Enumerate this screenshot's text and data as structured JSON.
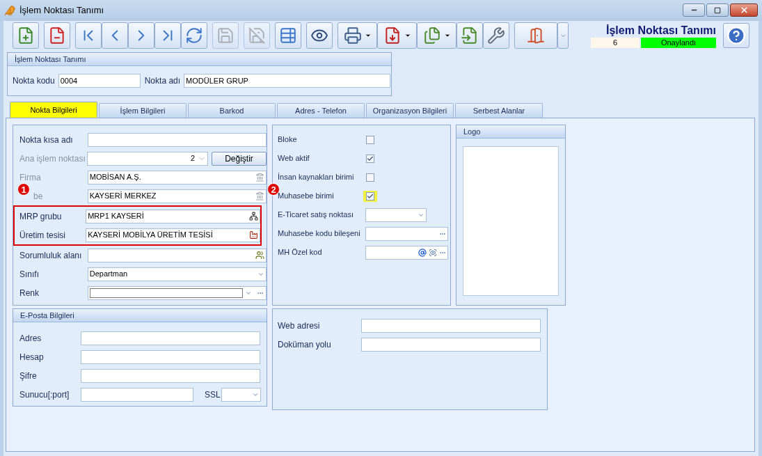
{
  "window": {
    "title": "İşlem Noktası Tanımı"
  },
  "toolbar": [
    [
      {
        "kind": "new",
        "disabled": false,
        "dropdown": false
      }
    ],
    [
      {
        "kind": "delete",
        "disabled": false,
        "dropdown": false
      }
    ],
    [
      {
        "kind": "first",
        "disabled": false,
        "dropdown": false
      },
      {
        "kind": "prev",
        "disabled": false,
        "dropdown": false
      },
      {
        "kind": "next",
        "disabled": false,
        "dropdown": false
      },
      {
        "kind": "last",
        "disabled": false,
        "dropdown": false
      },
      {
        "kind": "refresh",
        "disabled": false,
        "dropdown": false
      }
    ],
    [
      {
        "kind": "save",
        "disabled": true,
        "dropdown": false
      }
    ],
    [
      {
        "kind": "cancel",
        "disabled": true,
        "dropdown": false
      }
    ],
    [
      {
        "kind": "find",
        "disabled": false,
        "dropdown": false
      }
    ],
    [
      {
        "kind": "preview",
        "disabled": false,
        "dropdown": false
      }
    ],
    [
      {
        "kind": "print",
        "disabled": false,
        "dropdown": true
      },
      {
        "kind": "pdf",
        "disabled": false,
        "dropdown": true
      },
      {
        "kind": "export",
        "disabled": false,
        "dropdown": true
      },
      {
        "kind": "import",
        "disabled": false,
        "dropdown": false
      },
      {
        "kind": "tools",
        "disabled": false,
        "dropdown": false
      }
    ],
    [
      {
        "kind": "exit",
        "disabled": false,
        "dropdown": true
      }
    ]
  ],
  "header": {
    "title": "İşlem Noktası Tanımı",
    "record_no": "6",
    "status": "Onaylandı"
  },
  "point_group": {
    "title": "İşlem Noktası Tanımı",
    "fields": [
      {
        "label": "Nokta kodu",
        "value": "0004"
      },
      {
        "label": "Nokta adı",
        "value": "MODÜLER GRUP"
      }
    ]
  },
  "tabs": [
    {
      "label": "Nokta Bilgileri",
      "selected": true
    },
    {
      "label": "İşlem Bilgileri",
      "selected": false
    },
    {
      "label": "Barkod",
      "selected": false
    },
    {
      "label": "Adres - Telefon",
      "selected": false
    },
    {
      "label": "Organizasyon Bilgileri",
      "selected": false
    },
    {
      "label": "Serbest Alanlar",
      "selected": false
    }
  ],
  "left_fields": [
    {
      "label": "Nokta kısa adı",
      "kind": "text",
      "disabled": false
    },
    {
      "label": "Ana işlem noktası",
      "kind": "spin",
      "value": "2",
      "button": "Değiştir",
      "disabled": true
    },
    {
      "label": "Firma",
      "kind": "bank",
      "value": "MOBİSAN A.Ş.",
      "disabled": true
    },
    {
      "label": "be",
      "kind": "bank",
      "value": "KAYSERİ MERKEZ",
      "disabled": true,
      "badge": "1"
    },
    {
      "kind": "frame",
      "children": [
        {
          "label": "MRP grubu",
          "kind": "tree",
          "value": "MRP1 KAYSERİ",
          "disabled": false
        },
        {
          "label": "Üretim tesisi",
          "kind": "factory",
          "value": "KAYSERİ MOBİLYA ÜRETİM TESİSİ",
          "disabled": false
        }
      ]
    },
    {
      "label": "Sorumluluk alanı",
      "kind": "people",
      "disabled": false
    },
    {
      "label": "Sınıfı",
      "kind": "dropdown",
      "value": "Departman",
      "disabled": false
    },
    {
      "label": "Renk",
      "kind": "color",
      "disabled": false
    }
  ],
  "middle_fields": [
    {
      "label": "Bloke",
      "kind": "check",
      "checked": false,
      "highlighted": false
    },
    {
      "label": "Web aktif",
      "kind": "check",
      "checked": true,
      "highlighted": false
    },
    {
      "label": "İnsan kaynakları birimi",
      "kind": "check",
      "checked": false,
      "highlighted": false
    },
    {
      "label": "Muhasebe birimi",
      "kind": "check",
      "checked": true,
      "highlighted": true,
      "badge": "2"
    },
    {
      "label": "E-Ticaret satış noktası",
      "kind": "dropdown"
    },
    {
      "label": "Muhasebe kodu bileşeni",
      "kind": "ellipsis"
    },
    {
      "label": "MH Özel kod",
      "kind": "code"
    }
  ],
  "logo": {
    "title": "Logo"
  },
  "email": {
    "title": "E-Posta Bilgileri",
    "fields": [
      {
        "label": "Adres",
        "kind": "text"
      },
      {
        "label": "Hesap",
        "kind": "text"
      },
      {
        "label": "Şifre",
        "kind": "text"
      },
      {
        "label": "Sunucu[:port]",
        "kind": "server",
        "extra_label": "SSL"
      }
    ]
  },
  "web_fields": [
    {
      "label": "Web adresi"
    },
    {
      "label": "Doküman yolu"
    }
  ]
}
